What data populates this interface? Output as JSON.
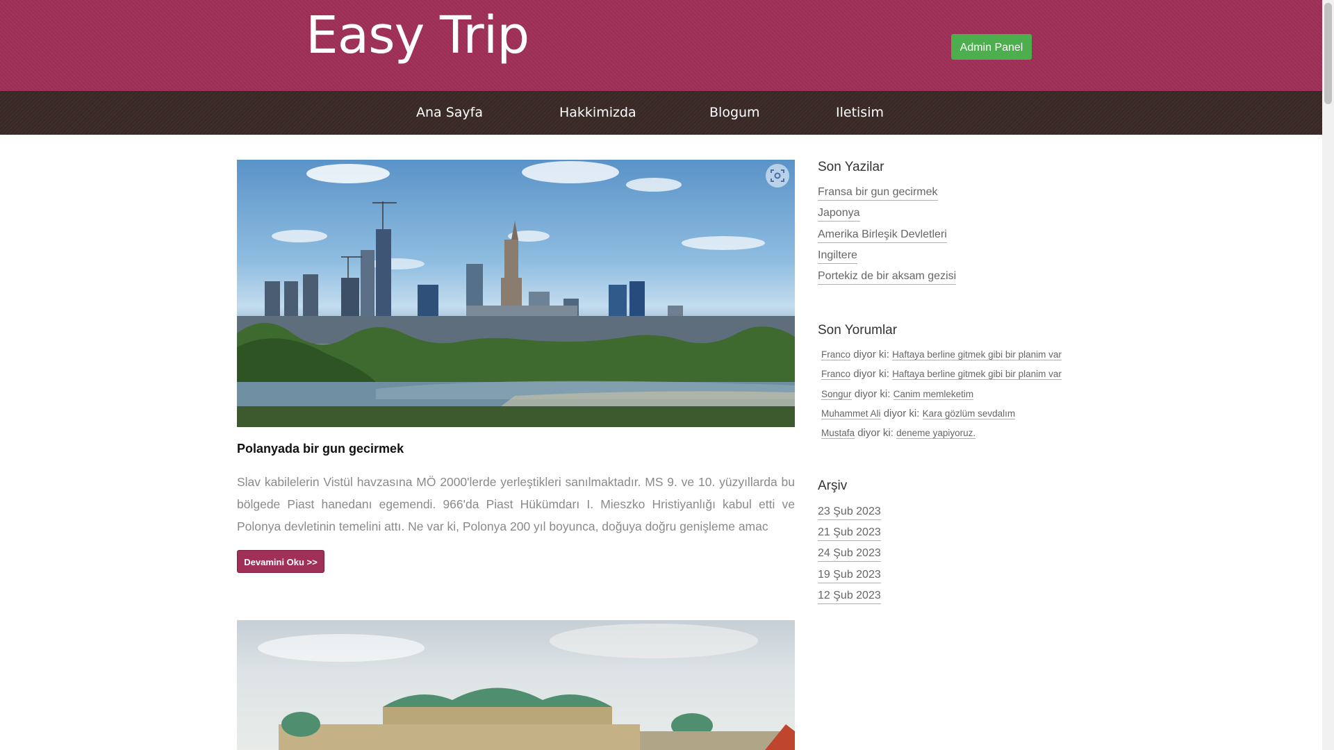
{
  "header": {
    "logo": "Easy Trip",
    "admin_button": "Admin Panel",
    "colors": {
      "header_bg": "#a03058",
      "nav_bg": "#3b2a27",
      "admin_btn": "#4cae4c"
    }
  },
  "nav": {
    "items": [
      "Ana Sayfa",
      "Hakkimizda",
      "Blogum",
      "Iletisim"
    ]
  },
  "post": {
    "title": "Polanyada bir gun gecirmek",
    "excerpt": "Slav kabilelerin Vistül havzasına MÖ 2000'lerde yerleştikleri sanılmaktadır. MS 9. ve 10. yüzyıllarda bu bölgede Piast hanedanı egemendi. 966'da Piast Hükümdarı I. Mieszko Hristiyanlığı kabul etti ve Polonya devletinin temelini attı. Ne var ki, Polonya 200 yıl boyunca, doğuya doğru genişleme amac",
    "read_more": "Devamini Oku >>",
    "image_icon": "visual-search-icon"
  },
  "sidebar": {
    "recent_posts": {
      "title": "Son Yazilar",
      "items": [
        "Fransa bir gun gecirmek",
        "Japonya",
        "Amerika Birleşik Devletleri",
        "Ingiltere",
        "Portekiz de bir aksam gezisi"
      ]
    },
    "recent_comments": {
      "title": "Son Yorumlar",
      "says": "diyor ki:",
      "items": [
        {
          "author": "Franco",
          "post": "Haftaya berline gitmek gibi bir planim var"
        },
        {
          "author": "Franco",
          "post": "Haftaya berline gitmek gibi bir planim var"
        },
        {
          "author": "Songur",
          "post": "Canim memleketim"
        },
        {
          "author": "Muhammet Ali",
          "post": "Kara gözlüm sevdalım"
        },
        {
          "author": "Mustafa",
          "post": "deneme yapiyoruz."
        }
      ]
    },
    "archive": {
      "title": "Arşiv",
      "items": [
        "23 Şub 2023",
        "21 Şub 2023",
        "24 Şub 2023",
        "19 Şub 2023",
        "12 Şub 2023"
      ]
    }
  }
}
